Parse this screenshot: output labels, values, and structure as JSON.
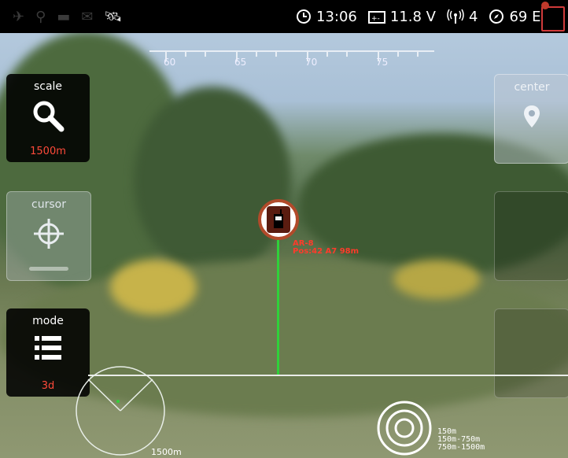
{
  "status": {
    "time": "13:06",
    "voltage": "11.8 V",
    "signal": "4",
    "heading": "69 E"
  },
  "ruler": {
    "ticks": [
      "60",
      "65",
      "70",
      "75"
    ]
  },
  "panels": {
    "scale": {
      "title": "scale",
      "value": "1500m"
    },
    "cursor": {
      "title": "cursor"
    },
    "mode": {
      "title": "mode",
      "value": "3d"
    },
    "center": {
      "title": "center"
    }
  },
  "target": {
    "line1": "AR-8",
    "line2": "Pos:42 A7 98m"
  },
  "radar": {
    "range": "1500m"
  },
  "legend": [
    "150m",
    "150m-750m",
    "750m-1500m"
  ],
  "colors": {
    "accent": "#ff4a3a",
    "stem": "#2fd13a",
    "marker_ring": "#b14a2a"
  }
}
